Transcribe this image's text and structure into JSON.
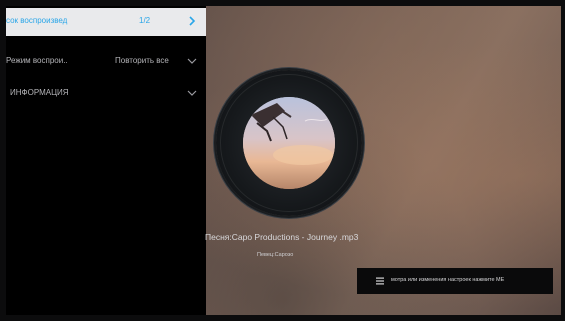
{
  "menu": {
    "items": [
      {
        "label": "сок воспроизвед",
        "value": "1/2",
        "chevron": "chevron-right-icon",
        "active": true
      },
      {
        "label": "Режим воспрои..",
        "value": "Повторить все",
        "chevron": "chevron-down-icon",
        "active": false
      },
      {
        "label": "ИНФОРМАЦИЯ",
        "value": "",
        "chevron": "chevron-down-icon",
        "active": false
      }
    ]
  },
  "player": {
    "song_line": "Песня:Capo Productions - Journey .mp3",
    "artist_line": "Певец:Сарозо"
  },
  "hint": {
    "icon": "menu-icon",
    "text": "мотра или изменения настроек нажмите МЕ"
  },
  "colors": {
    "accent": "#2aa6e8",
    "panel_bg": "#000000",
    "active_row_bg": "#e9eaec"
  }
}
